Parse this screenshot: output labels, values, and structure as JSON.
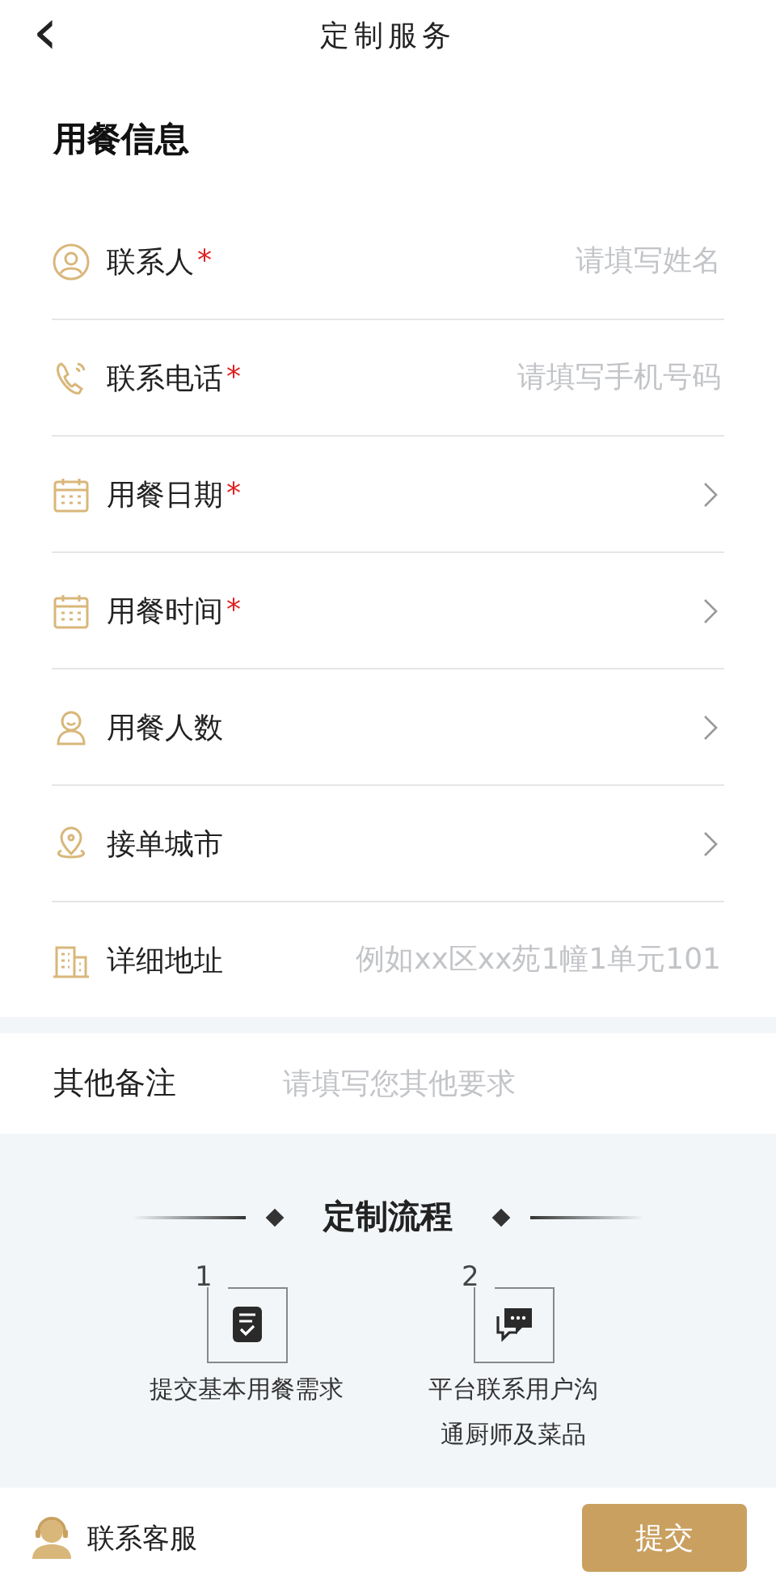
{
  "header": {
    "back": "‹",
    "title": "定制服务"
  },
  "section_title": "用餐信息",
  "rows": [
    {
      "kind": "input",
      "label": "联系人",
      "mark": "*",
      "placeholder": "请填写姓名"
    },
    {
      "kind": "input",
      "label": "联系电话",
      "mark": "*",
      "placeholder": "请填写手机号码"
    },
    {
      "kind": "select",
      "label": "用餐日期",
      "mark": "*"
    },
    {
      "kind": "select",
      "label": "用餐时间",
      "mark": "*"
    },
    {
      "kind": "select",
      "label": "用餐人数"
    },
    {
      "kind": "select",
      "label": "接单城市"
    },
    {
      "kind": "input",
      "label": "详细地址",
      "placeholder": "例如xx区xx苑1幢1单元101"
    }
  ],
  "remarks": {
    "label": "其他备注",
    "placeholder": "请填写您其他要求"
  },
  "process": {
    "title": "定制流程",
    "steps": [
      {
        "number": "1",
        "lines": [
          "提交基本用餐需求"
        ]
      },
      {
        "number": "2",
        "lines": [
          "平台联系用户沟",
          "通厨师及菜品"
        ]
      }
    ]
  },
  "footer": {
    "service": "联系客服",
    "submit": "提交"
  }
}
